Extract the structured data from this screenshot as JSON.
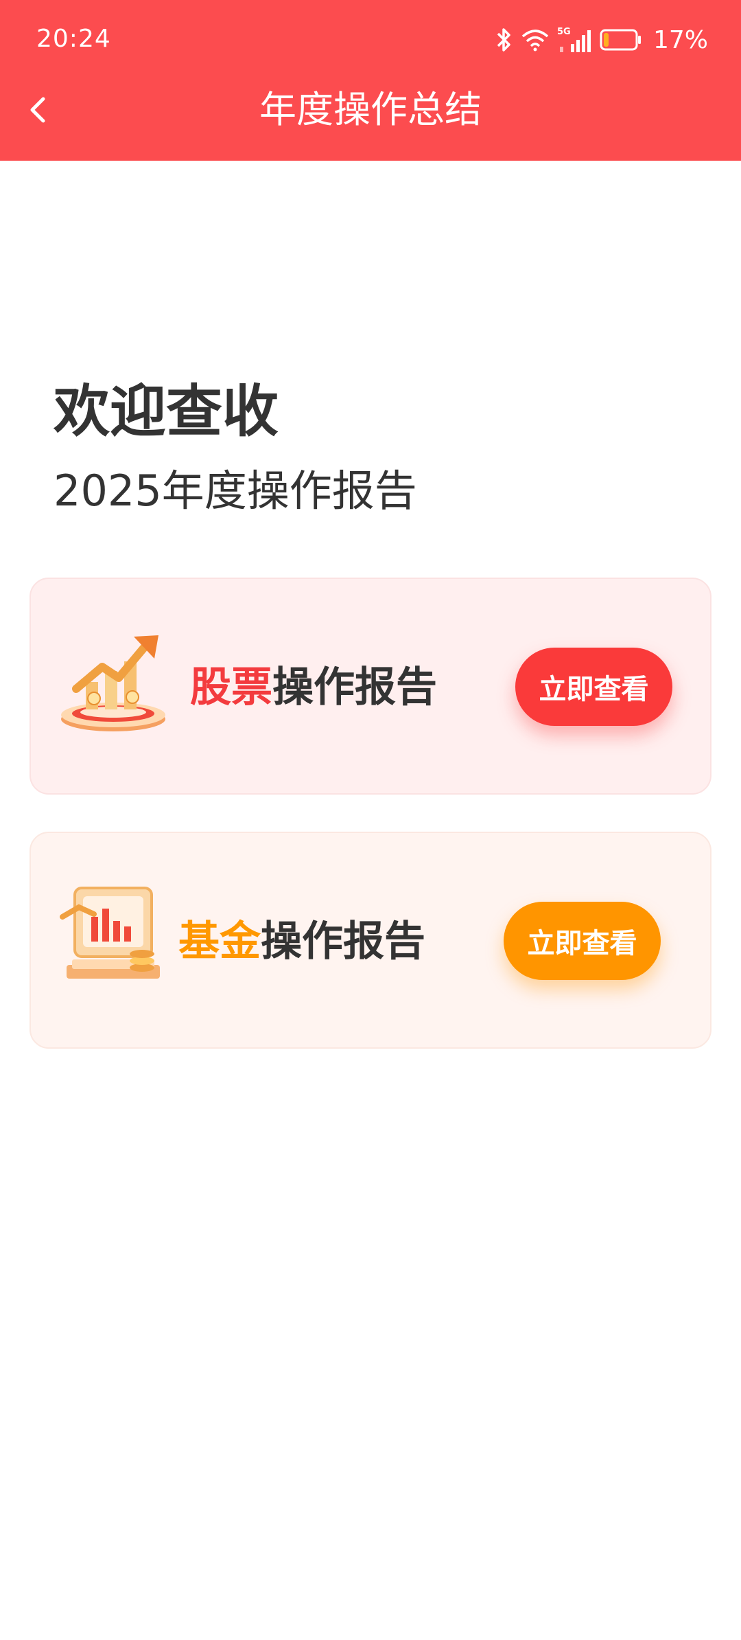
{
  "status_bar": {
    "time": "20:24",
    "network": "5G",
    "battery_percent": "17%",
    "battery_level": 0.17
  },
  "nav": {
    "back_icon": "chevron-left-icon",
    "title": "年度操作总结"
  },
  "welcome": {
    "title": "欢迎查收",
    "subtitle": "2025年度操作报告"
  },
  "cards": [
    {
      "accent": "股票",
      "title_rest": "操作报告",
      "accent_color": "#F33B3E",
      "icon": "stock-chart-icon",
      "button_label": "立即查看",
      "button_color": "#FA3A3A"
    },
    {
      "accent": "基金",
      "title_rest": "操作报告",
      "accent_color": "#FF9800",
      "icon": "fund-monitor-icon",
      "button_label": "立即查看",
      "button_color": "#FF9500"
    }
  ],
  "colors": {
    "header_bg": "#FC4C4F",
    "stock_card_bg": "#FFEFEF",
    "fund_card_bg": "#FFF4F0"
  }
}
